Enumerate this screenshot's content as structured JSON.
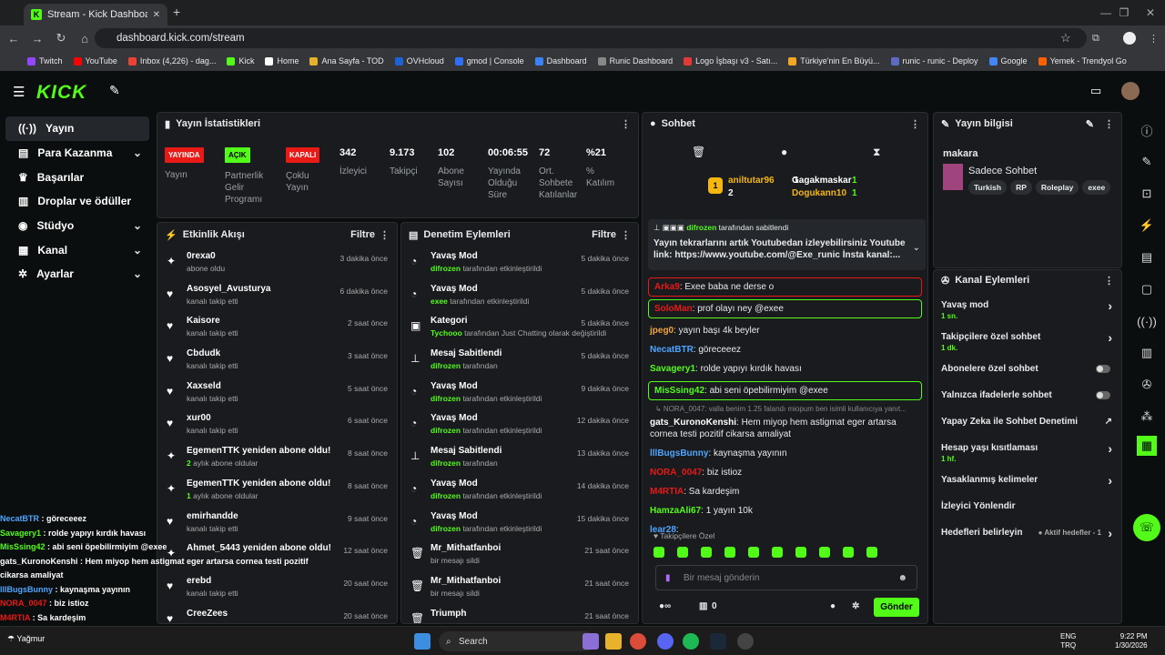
{
  "browser": {
    "tab_title": "Stream - Kick Dashboard",
    "url": "dashboard.kick.com/stream",
    "bookmarks": [
      "Twitch",
      "YouTube",
      "Inbox (4,226) - dag...",
      "Kick",
      "Home",
      "Ana Sayfa - TOD",
      "OVHcloud",
      "gmod | Console",
      "Dashboard",
      "Runic Dashboard",
      "Logo İşbaşı v3 - Satı...",
      "Türkiye'nin En Büyü...",
      "runic - runic - Deploy",
      "Google",
      "Yemek - Trendyol Go"
    ]
  },
  "logo": "KICK",
  "sidebar": {
    "items": [
      {
        "label": "Yayın"
      },
      {
        "label": "Para Kazanma"
      },
      {
        "label": "Başarılar"
      },
      {
        "label": "Droplar ve ödüller"
      },
      {
        "label": "Stüdyo"
      },
      {
        "label": "Kanal"
      },
      {
        "label": "Ayarlar"
      }
    ]
  },
  "stats": {
    "title": "Yayın İstatistikleri",
    "badges": [
      {
        "badge": "YAYINDA",
        "label": "Yayın"
      },
      {
        "badge": "AÇIK",
        "label": "Partnerlik Gelir Programı"
      },
      {
        "badge": "KAPALI",
        "label": "Çoklu Yayın"
      }
    ],
    "values": [
      {
        "v": "342",
        "l": "İzleyici"
      },
      {
        "v": "9.173",
        "l": "Takipçi"
      },
      {
        "v": "102",
        "l": "Abone Sayısı"
      },
      {
        "v": "00:06:55",
        "l": "Yayında Olduğu Süre"
      },
      {
        "v": "72",
        "l": "Ort. Sohbete Katılanlar"
      },
      {
        "v": "%21",
        "l": "% Katılım"
      }
    ]
  },
  "activity": {
    "title": "Etkinlik Akışı",
    "filter": "Filtre",
    "rows": [
      {
        "t": "0rexa0",
        "s": "abone oldu",
        "time": "3 dakika önce",
        "ic": "✦"
      },
      {
        "t": "Asosyel_Avusturya",
        "s": "kanalı takip etti",
        "time": "6 dakika önce",
        "ic": "♥"
      },
      {
        "t": "Kaisore",
        "s": "kanalı takip etti",
        "time": "2 saat önce",
        "ic": "♥"
      },
      {
        "t": "Cbdudk",
        "s": "kanalı takip etti",
        "time": "3 saat önce",
        "ic": "♥"
      },
      {
        "t": "Xaxseld",
        "s": "kanalı takip etti",
        "time": "5 saat önce",
        "ic": "♥"
      },
      {
        "t": "xur00",
        "s": "kanalı takip etti",
        "time": "6 saat önce",
        "ic": "♥"
      },
      {
        "t": "EgemenTTK yeniden abone oldu!",
        "s": "aylık abone oldular",
        "n": "2",
        "time": "8 saat önce",
        "ic": "✦"
      },
      {
        "t": "EgemenTTK yeniden abone oldu!",
        "s": "aylık abone oldular",
        "n": "1",
        "time": "8 saat önce",
        "ic": "✦"
      },
      {
        "t": "emirhandde",
        "s": "kanalı takip etti",
        "time": "9 saat önce",
        "ic": "♥"
      },
      {
        "t": "Ahmet_5443 yeniden abone oldu!",
        "s": "",
        "time": "12 saat önce",
        "ic": "✦"
      },
      {
        "t": "erebd",
        "s": "kanalı takip etti",
        "time": "20 saat önce",
        "ic": "♥"
      },
      {
        "t": "CreeZees",
        "s": "",
        "time": "20 saat önce",
        "ic": "♥"
      }
    ]
  },
  "moderation": {
    "title": "Denetim Eylemleri",
    "filter": "Filtre",
    "rows": [
      {
        "t": "Yavaş Mod",
        "u": "difrozen",
        "s": "tarafından etkinleştirildi",
        "time": "5 dakika önce",
        "ic": "◔"
      },
      {
        "t": "Yavaş Mod",
        "u": "exee",
        "s": "tarafından etkinleştirildi",
        "time": "5 dakika önce",
        "ic": "◔"
      },
      {
        "t": "Kategori",
        "u": "Tychooo",
        "s": "tarafından Just Chatting olarak değiştirildi",
        "time": "5 dakika önce",
        "ic": "▣"
      },
      {
        "t": "Mesaj Sabitlendi",
        "u": "difrozen",
        "s": "tarafından",
        "time": "5 dakika önce",
        "ic": "⊥"
      },
      {
        "t": "Yavaş Mod",
        "u": "difrozen",
        "s": "tarafından etkinleştirildi",
        "time": "9 dakika önce",
        "ic": "◔"
      },
      {
        "t": "Yavaş Mod",
        "u": "difrozen",
        "s": "tarafından etkinleştirildi",
        "time": "12 dakika önce",
        "ic": "◔"
      },
      {
        "t": "Mesaj Sabitlendi",
        "u": "difrozen",
        "s": "tarafından",
        "time": "13 dakika önce",
        "ic": "⊥"
      },
      {
        "t": "Yavaş Mod",
        "u": "difrozen",
        "s": "tarafından etkinleştirildi",
        "time": "14 dakika önce",
        "ic": "◔"
      },
      {
        "t": "Yavaş Mod",
        "u": "difrozen",
        "s": "tarafından etkinleştirildi",
        "time": "15 dakika önce",
        "ic": "◔"
      },
      {
        "t": "Mr_Mithatfanboi",
        "u": "",
        "s": "bir mesajı sildi",
        "time": "21 saat önce",
        "ic": "🗑"
      },
      {
        "t": "Mr_Mithatfanboi",
        "u": "",
        "s": "bir mesajı sildi",
        "time": "21 saat önce",
        "ic": "🗑"
      },
      {
        "t": "Triumph",
        "u": "",
        "s": "",
        "time": "21 saat önce",
        "ic": "🗑"
      }
    ]
  },
  "chat": {
    "title": "Sohbet",
    "gifters": [
      {
        "name": "aniltutar96",
        "n": "1"
      },
      {
        "name": "Gagakmaskar",
        "n": "1"
      },
      {
        "name": "",
        "n": "2"
      },
      {
        "name": "Dogukann10",
        "n": "1"
      }
    ],
    "pinned_by": "difrozen",
    "pinned_suffix": "tarafından sabitlendi",
    "pinned_text": "Yayın tekrarlarını artık Youtubedan izleyebilirsiniz Youtube link: https://www.youtube.com/@Exe_runic İnsta kanal:...",
    "messages": [
      {
        "u": "Arka9",
        "m": "Exee baba ne derse o",
        "c": "#e91916",
        "hl": "r"
      },
      {
        "u": "SoloMan",
        "m": "prof olayı ney @exee",
        "c": "#e91916",
        "hl": "g"
      },
      {
        "u": "jpeg0",
        "m": "yayın başı 4k beyler",
        "c": "#f2a33a"
      },
      {
        "u": "NecatBTR",
        "m": "göreceeez",
        "c": "#4ea5ff"
      },
      {
        "u": "Savagery1",
        "m": "rolde yapıyı kırdık havası",
        "c": "#53fc18"
      },
      {
        "u": "MisSsing42",
        "m": "abi seni öpebilirmiyim @exee",
        "c": "#53fc18",
        "hl": "g"
      },
      {
        "u": "gats_KuronoKenshi",
        "m": "Hem miyop hem astigmat eger artarsa cornea testi pozitif cikarsa amaliyat",
        "c": "#fff",
        "reply": "NORA_0047: valla benim 1.25 falandı miopum ben isimli kullanıcıya yanıt..."
      },
      {
        "u": "lllBugsBunny",
        "m": "kaynaşma yayının",
        "c": "#4ea5ff"
      },
      {
        "u": "NORA_0047",
        "m": "biz istioz",
        "c": "#e91916"
      },
      {
        "u": "M4RTIA",
        "m": "Sa kardeşim",
        "c": "#e91916"
      },
      {
        "u": "HamzaAli67",
        "m": "1 yayın 10k",
        "c": "#53fc18"
      },
      {
        "u": "lear28",
        "m": "",
        "c": "#4ea5ff"
      }
    ],
    "followers_only": "Takipçilere Özel",
    "input_placeholder": "Bir mesaj gönderin",
    "points": "0",
    "send": "Gönder"
  },
  "info": {
    "title": "Yayın bilgisi",
    "streamer": "makara",
    "category": "Sadece Sohbet",
    "tags": [
      "Turkish",
      "RP",
      "Roleplay",
      "exee"
    ]
  },
  "actions": {
    "title": "Kanal Eylemleri",
    "items": [
      {
        "l": "Yavaş mod",
        "sub": "1 sn.",
        "type": "arr"
      },
      {
        "l": "Takipçilere özel sohbet",
        "sub": "1 dk.",
        "type": "arr"
      },
      {
        "l": "Abonelere özel sohbet",
        "type": "toggle"
      },
      {
        "l": "Yalnızca ifadelerle sohbet",
        "type": "toggle"
      },
      {
        "l": "Yapay Zeka ile Sohbet Denetimi",
        "type": "ext"
      },
      {
        "l": "Hesap yaşı kısıtlaması",
        "sub": "1 hf.",
        "type": "arr"
      },
      {
        "l": "Yasaklanmış kelimeler",
        "type": "arr"
      },
      {
        "l": "İzleyici Yönlendir",
        "type": "none"
      },
      {
        "l": "Hedefleri belirleyin",
        "extra": "Aktif hedefler - 1",
        "type": "arr"
      }
    ]
  },
  "overlay_chat": [
    {
      "u": "NecatBTR",
      "m": " : göreceeez",
      "c": "#4ea5ff"
    },
    {
      "u": "Savagery1",
      "m": " : rolde yapıyı kırdık havası",
      "c": "#53fc18"
    },
    {
      "u": "MisSsing42",
      "m": " : abi seni öpebilirmiyim @exee",
      "c": "#53fc18"
    },
    {
      "u": "gats_KuronoKenshi",
      "m": " : Hem miyop hem astigmat eger artarsa cornea testi pozitif",
      "c": "#fff"
    },
    {
      "u": "",
      "m": "cikarsa amaliyat",
      "c": "#fff"
    },
    {
      "u": "lllBugsBunny",
      "m": " : kaynaşma yayının",
      "c": "#4ea5ff"
    },
    {
      "u": "NORA_0047",
      "m": " : biz istioz",
      "c": "#e91916"
    },
    {
      "u": "M4RTIA",
      "m": " : Sa kardeşim",
      "c": "#e91916"
    },
    {
      "u": "HamzaAli67",
      "m": " : 1 yayın 10k",
      "c": "#53fc18"
    },
    {
      "u": "lear28",
      "m": "",
      "c": "#4ea5ff"
    }
  ],
  "taskbar": {
    "weather": "Yağmur",
    "search": "Search",
    "lang": "ENG",
    "lang2": "TRQ",
    "time": "9:22 PM",
    "date": "1/30/2026"
  }
}
